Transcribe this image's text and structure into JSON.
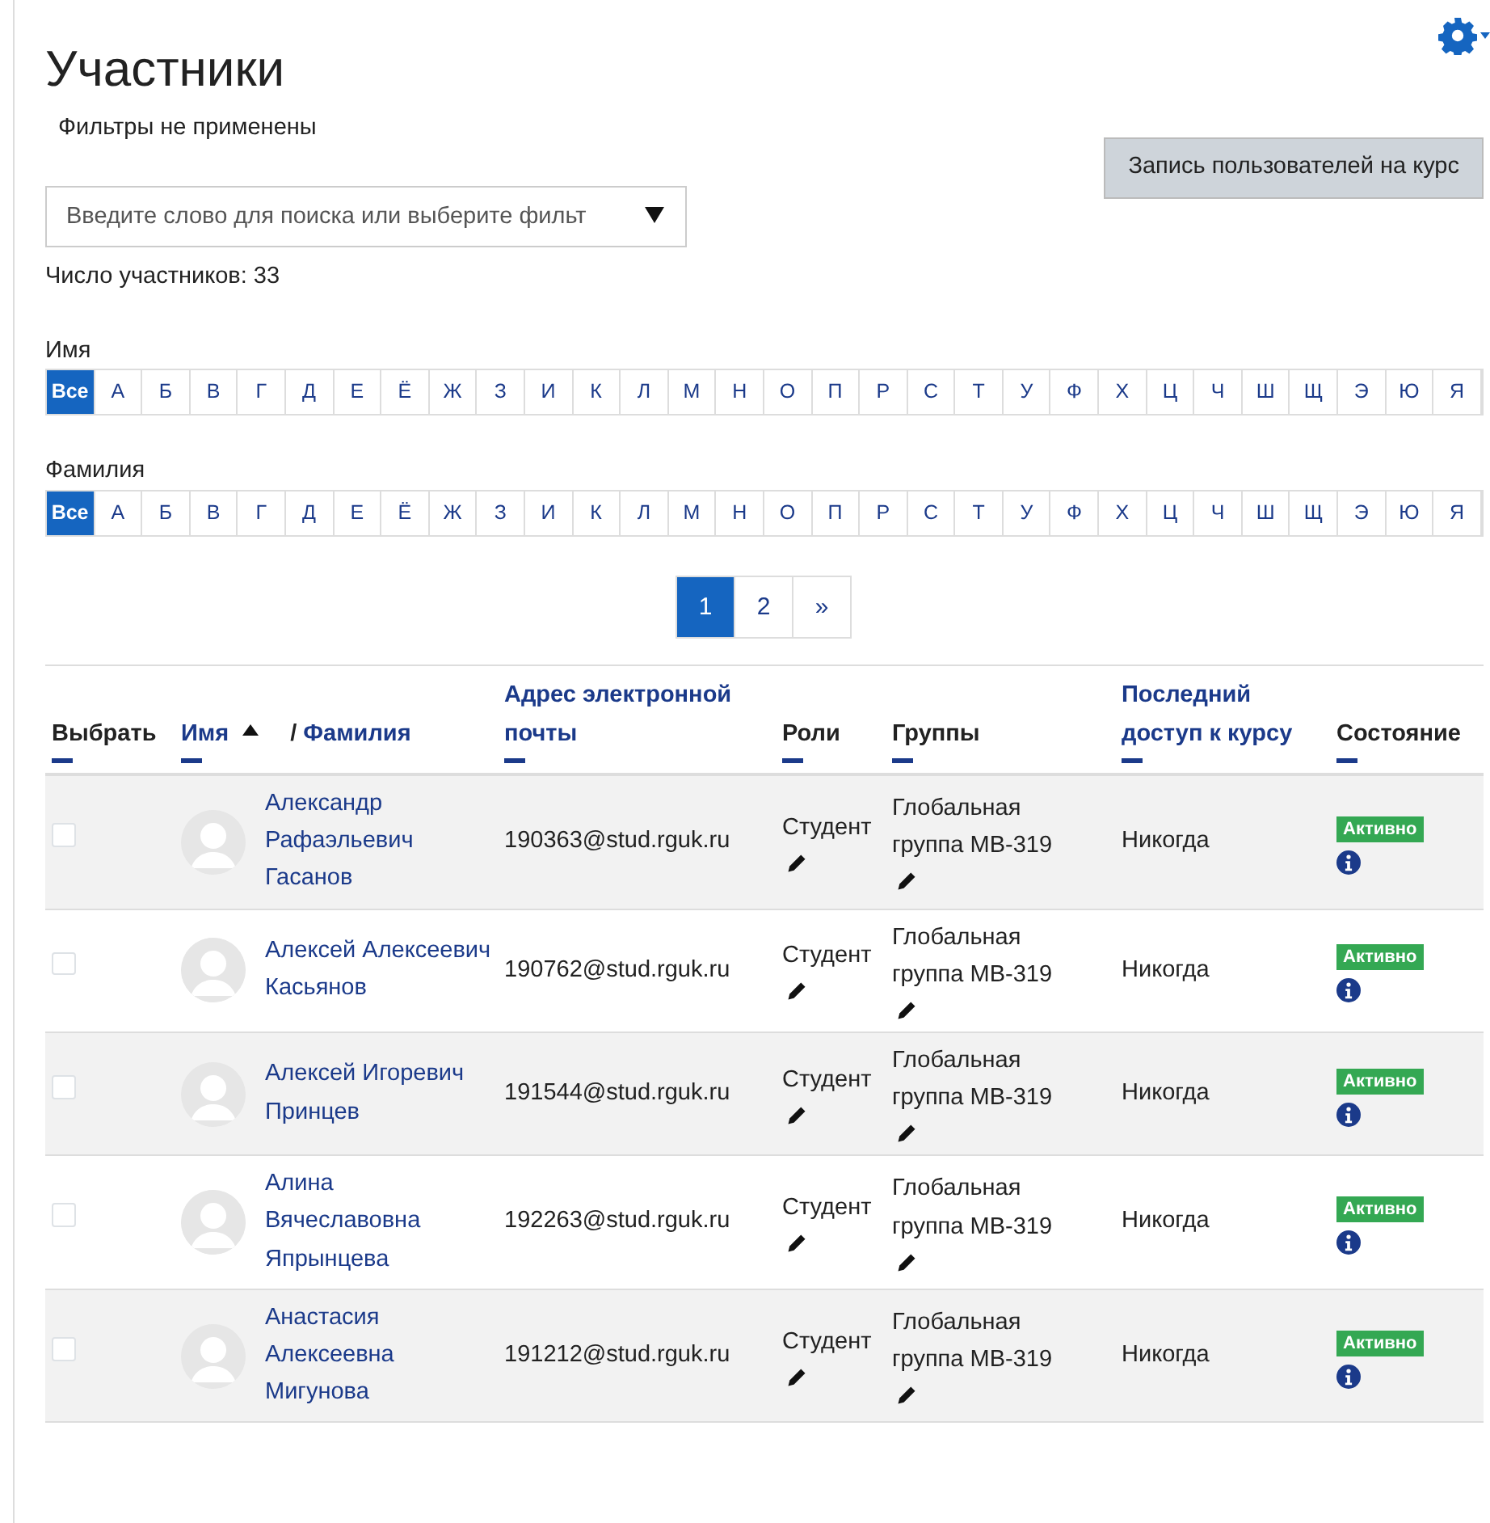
{
  "page": {
    "title": "Участники",
    "filters_note": "Фильтры не применены",
    "enrol_button": "Запись пользователей на курс",
    "search": {
      "placeholder": "Введите слово для поиска или выберите фильт"
    },
    "participant_count": "Число участников: 33"
  },
  "initials_filters": [
    {
      "label": "Имя",
      "letters": [
        {
          "text": "Все",
          "selected": true
        },
        {
          "text": "А",
          "selected": false
        },
        {
          "text": "Б",
          "selected": false
        },
        {
          "text": "В",
          "selected": false
        },
        {
          "text": "Г",
          "selected": false
        },
        {
          "text": "Д",
          "selected": false
        },
        {
          "text": "Е",
          "selected": false
        },
        {
          "text": "Ё",
          "selected": false
        },
        {
          "text": "Ж",
          "selected": false
        },
        {
          "text": "З",
          "selected": false
        },
        {
          "text": "И",
          "selected": false
        },
        {
          "text": "К",
          "selected": false
        },
        {
          "text": "Л",
          "selected": false
        },
        {
          "text": "М",
          "selected": false
        },
        {
          "text": "Н",
          "selected": false
        },
        {
          "text": "О",
          "selected": false
        },
        {
          "text": "П",
          "selected": false
        },
        {
          "text": "Р",
          "selected": false
        },
        {
          "text": "С",
          "selected": false
        },
        {
          "text": "Т",
          "selected": false
        },
        {
          "text": "У",
          "selected": false
        },
        {
          "text": "Ф",
          "selected": false
        },
        {
          "text": "Х",
          "selected": false
        },
        {
          "text": "Ц",
          "selected": false
        },
        {
          "text": "Ч",
          "selected": false
        },
        {
          "text": "Ш",
          "selected": false
        },
        {
          "text": "Щ",
          "selected": false
        },
        {
          "text": "Э",
          "selected": false
        },
        {
          "text": "Ю",
          "selected": false
        },
        {
          "text": "Я",
          "selected": false
        }
      ]
    },
    {
      "label": "Фамилия",
      "letters": [
        {
          "text": "Все",
          "selected": true
        },
        {
          "text": "А",
          "selected": false
        },
        {
          "text": "Б",
          "selected": false
        },
        {
          "text": "В",
          "selected": false
        },
        {
          "text": "Г",
          "selected": false
        },
        {
          "text": "Д",
          "selected": false
        },
        {
          "text": "Е",
          "selected": false
        },
        {
          "text": "Ё",
          "selected": false
        },
        {
          "text": "Ж",
          "selected": false
        },
        {
          "text": "З",
          "selected": false
        },
        {
          "text": "И",
          "selected": false
        },
        {
          "text": "К",
          "selected": false
        },
        {
          "text": "Л",
          "selected": false
        },
        {
          "text": "М",
          "selected": false
        },
        {
          "text": "Н",
          "selected": false
        },
        {
          "text": "О",
          "selected": false
        },
        {
          "text": "П",
          "selected": false
        },
        {
          "text": "Р",
          "selected": false
        },
        {
          "text": "С",
          "selected": false
        },
        {
          "text": "Т",
          "selected": false
        },
        {
          "text": "У",
          "selected": false
        },
        {
          "text": "Ф",
          "selected": false
        },
        {
          "text": "Х",
          "selected": false
        },
        {
          "text": "Ц",
          "selected": false
        },
        {
          "text": "Ч",
          "selected": false
        },
        {
          "text": "Ш",
          "selected": false
        },
        {
          "text": "Щ",
          "selected": false
        },
        {
          "text": "Э",
          "selected": false
        },
        {
          "text": "Ю",
          "selected": false
        },
        {
          "text": "Я",
          "selected": false
        }
      ]
    }
  ],
  "pagination": [
    {
      "text": "1",
      "selected": true
    },
    {
      "text": "2",
      "selected": false
    },
    {
      "text": "»",
      "selected": false
    }
  ],
  "table": {
    "columns": [
      {
        "kind": "plain",
        "label": "Выбрать"
      },
      {
        "kind": "name",
        "first": "Имя",
        "sort_ascending": true,
        "separator": "/",
        "second": "Фамилия"
      },
      {
        "kind": "link",
        "label": "Адрес электронной почты"
      },
      {
        "kind": "plain",
        "label": "Роли"
      },
      {
        "kind": "plain",
        "label": "Группы"
      },
      {
        "kind": "link",
        "label": "Последний доступ к курсу"
      },
      {
        "kind": "plain",
        "label": "Состояние"
      }
    ],
    "rows": [
      {
        "checked": false,
        "name": "Александр Рафаэльевич Гасанов",
        "email": "190363@stud.rguk.ru",
        "role": "Студент",
        "group": "Глобальная группа МВ-319",
        "last_access": "Никогда",
        "status": "Активно"
      },
      {
        "checked": false,
        "name": "Алексей Алексеевич Касьянов",
        "email": "190762@stud.rguk.ru",
        "role": "Студент",
        "group": "Глобальная группа МВ-319",
        "last_access": "Никогда",
        "status": "Активно"
      },
      {
        "checked": false,
        "name": "Алексей Игоревич Принцев",
        "email": "191544@stud.rguk.ru",
        "role": "Студент",
        "group": "Глобальная группа МВ-319",
        "last_access": "Никогда",
        "status": "Активно"
      },
      {
        "checked": false,
        "name": "Алина Вячеславовна Япрынцева",
        "email": "192263@stud.rguk.ru",
        "role": "Студент",
        "group": "Глобальная группа МВ-319",
        "last_access": "Никогда",
        "status": "Активно"
      },
      {
        "checked": false,
        "name": "Анастасия Алексеевна Мигунова",
        "email": "191212@stud.rguk.ru",
        "role": "Студент",
        "group": "Глобальная группа МВ-319",
        "last_access": "Никогда",
        "status": "Активно"
      }
    ]
  }
}
